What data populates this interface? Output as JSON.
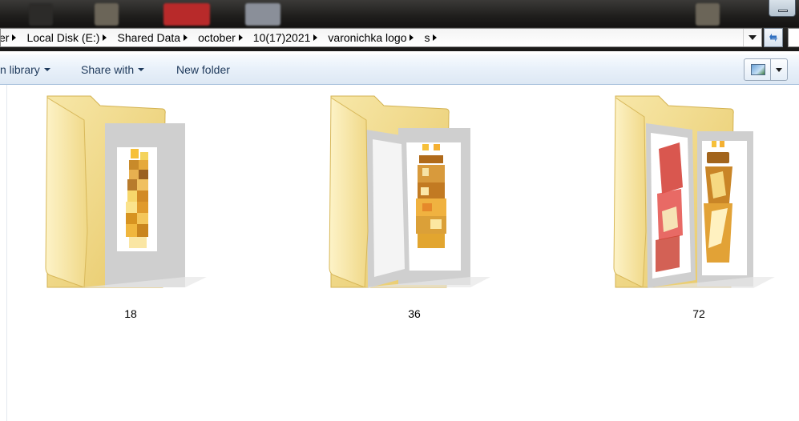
{
  "window": {
    "title_bar": {
      "minimize_icon": "minimize-icon",
      "blurred_taskbar_icons": 5
    }
  },
  "address_bar": {
    "breadcrumbs": [
      "er",
      "Local Disk (E:)",
      "Shared Data",
      "october",
      "10(17)2021",
      "varonichka logo",
      "s"
    ],
    "dropdown_icon": "chevron-down-icon",
    "refresh_icon": "refresh-icon"
  },
  "toolbar": {
    "include_in_library": "n library",
    "share_with": "Share with",
    "new_folder": "New folder",
    "view_icon": "change-view-icon"
  },
  "folders": [
    {
      "name": "18",
      "pixelation": "coarse"
    },
    {
      "name": "36",
      "pixelation": "medium"
    },
    {
      "name": "72",
      "pixelation": "fine"
    }
  ],
  "colors": {
    "folder_yellow": "#f2d98a",
    "toolbar_text": "#1e395b",
    "command_bar_top": "#f8fbfe",
    "command_bar_bottom": "#dde8f4"
  }
}
